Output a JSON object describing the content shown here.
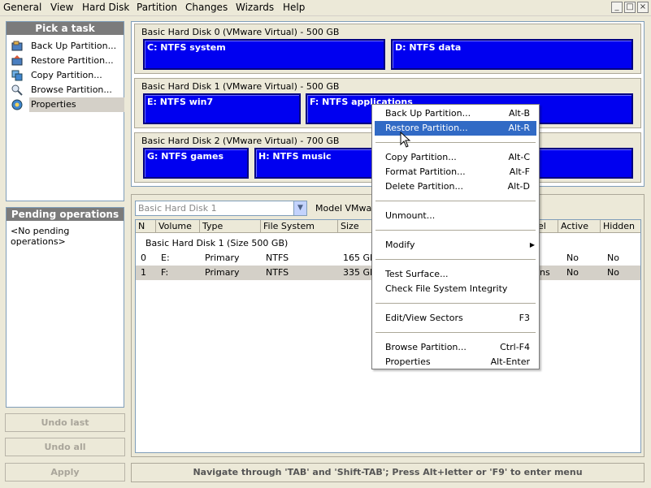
{
  "menubar": {
    "items": [
      "General",
      "View",
      "Hard Disk",
      "Partition",
      "Changes",
      "Wizards",
      "Help"
    ]
  },
  "window_controls": {
    "minimize": "_",
    "maximize": "□",
    "close": "×"
  },
  "tasks_panel": {
    "title": "Pick a task",
    "items": [
      {
        "label": "Back Up Partition...",
        "icon": "backup-icon"
      },
      {
        "label": "Restore Partition...",
        "icon": "restore-icon"
      },
      {
        "label": "Copy Partition...",
        "icon": "copy-icon"
      },
      {
        "label": "Browse Partition...",
        "icon": "browse-icon"
      },
      {
        "label": "Properties",
        "icon": "properties-icon",
        "selected": true
      }
    ]
  },
  "pending_panel": {
    "title": "Pending operations",
    "text": "<No pending operations>"
  },
  "buttons": {
    "undo_last": "Undo last",
    "undo_all": "Undo all",
    "apply": "Apply"
  },
  "disks": [
    {
      "label": "Basic Hard Disk 0 (VMware Virtual) - 500 GB",
      "partitions": [
        "C: NTFS system",
        "D: NTFS data"
      ]
    },
    {
      "label": "Basic Hard Disk 1 (VMware Virtual) - 500 GB",
      "partitions": [
        "E: NTFS win7",
        "F: NTFS applications"
      ]
    },
    {
      "label": "Basic Hard Disk 2 (VMware Virtual) - 700 GB",
      "partitions": [
        "G: NTFS games",
        "H: NTFS music"
      ]
    }
  ],
  "disk_selector": {
    "value": "Basic Hard Disk 1",
    "model_label": "Model VMware"
  },
  "table": {
    "headers": [
      "N",
      "Volume",
      "Type",
      "File System",
      "Size",
      "el",
      "Active",
      "Hidden"
    ],
    "group_label": "Basic Hard Disk 1 (Size 500 GB)",
    "rows": [
      {
        "n": "0",
        "volume": "E:",
        "type": "Primary",
        "fs": "NTFS",
        "size": "165 GB",
        "label": "",
        "active": "No",
        "hidden": "No"
      },
      {
        "n": "1",
        "volume": "F:",
        "type": "Primary",
        "fs": "NTFS",
        "size": "335 GB",
        "label": "ns",
        "active": "No",
        "hidden": "No"
      }
    ]
  },
  "status_bar": "Navigate through 'TAB' and 'Shift-TAB'; Press Alt+letter or 'F9' to enter menu",
  "context_menu": {
    "items": [
      {
        "label": "Back Up Partition...",
        "shortcut": "Alt-B"
      },
      {
        "label": "Restore Partition...",
        "shortcut": "Alt-R",
        "highlighted": true
      },
      {
        "label": "Copy Partition...",
        "shortcut": "Alt-C"
      },
      {
        "label": "Format Partition...",
        "shortcut": "Alt-F"
      },
      {
        "label": "Delete Partition...",
        "shortcut": "Alt-D"
      },
      {
        "label": "Unmount...",
        "shortcut": ""
      },
      {
        "label": "Modify",
        "shortcut": "▶"
      },
      {
        "label": "Test Surface...",
        "shortcut": ""
      },
      {
        "label": "Check File System Integrity",
        "shortcut": ""
      },
      {
        "label": "Edit/View Sectors",
        "shortcut": "F3"
      },
      {
        "label": "Browse Partition...",
        "shortcut": "Ctrl-F4"
      },
      {
        "label": "Properties",
        "shortcut": "Alt-Enter"
      }
    ]
  },
  "colors": {
    "partition_fill": "#0000f0",
    "highlight": "#316ac5",
    "panel_title": "#7b7b7b"
  }
}
